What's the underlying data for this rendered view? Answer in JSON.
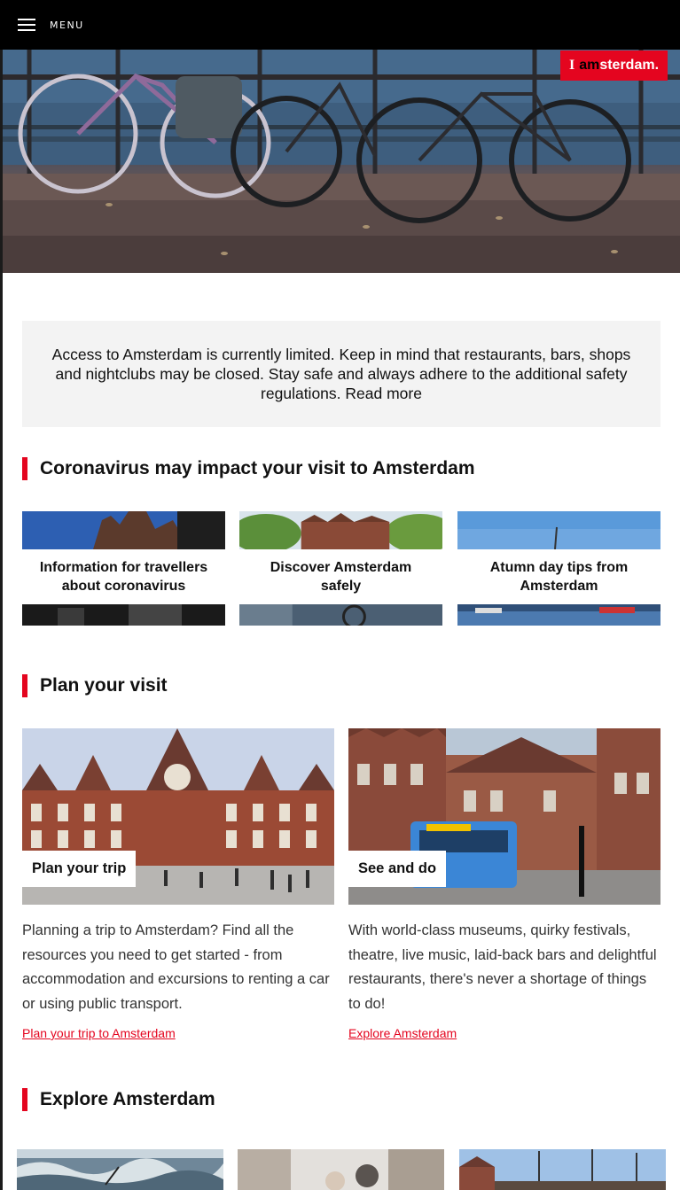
{
  "topbar": {
    "menu_label": "MENU"
  },
  "logo": {
    "prefix": "I",
    "am": "am",
    "rest": "sterdam",
    "dot": "."
  },
  "notice": {
    "text": "Access to Amsterdam is currently limited. Keep in mind that restaurants, bars, shops and nightclubs may be closed. Stay safe and always adhere to the additional safety regulations. Read more"
  },
  "sections": {
    "corona": {
      "title": "Coronavirus may impact your visit to Amsterdam"
    },
    "plan": {
      "title": "Plan your visit"
    },
    "explore": {
      "title": "Explore Amsterdam"
    }
  },
  "corona_cards": [
    {
      "label": "Information for travellers about coronavirus"
    },
    {
      "label": "Discover Amsterdam safely"
    },
    {
      "label": "Atumn day tips from Amsterdam"
    }
  ],
  "plan_cards": [
    {
      "tag": "Plan your trip",
      "description": "Planning a trip to Amsterdam? Find all the resources you need to get started - from accommodation and excursions to renting a car or using public transport.",
      "link": "Plan your trip to Amsterdam"
    },
    {
      "tag": "See and do",
      "description": "With world-class museums, quirky festivals, theatre, live music, laid-back bars and delightful restaurants, there's never a shortage of things to do!",
      "link": "Explore Amsterdam"
    }
  ],
  "colors": {
    "accent": "#e4051f",
    "notice_bg": "#f3f3f3",
    "topbar": "#000000"
  }
}
